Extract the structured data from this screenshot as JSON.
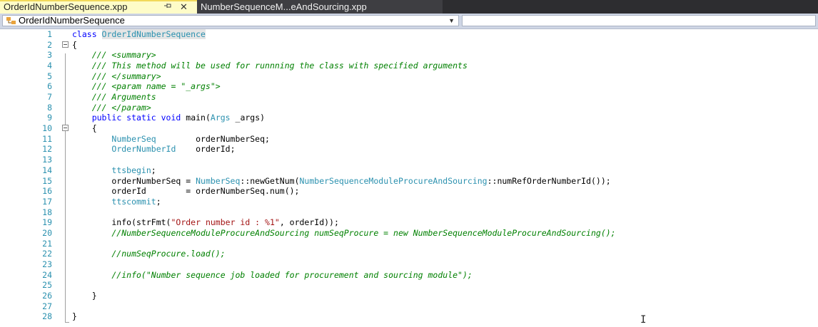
{
  "tabs": [
    {
      "label": "OrderIdNumberSequence.xpp",
      "pin_icon": "pin-icon",
      "close_glyph": "✕"
    },
    {
      "label": "NumberSequenceM...eAndSourcing.xpp"
    }
  ],
  "navbar": {
    "type_selector": "OrderIdNumberSequence",
    "member_selector": ""
  },
  "colors": {
    "keyword": "#0000ff",
    "type": "#2b91af",
    "comment": "#008000",
    "string": "#a31515",
    "line_number": "#2b91af"
  },
  "code": {
    "lines": [
      {
        "num": "1",
        "tokens": [
          {
            "c": "kw",
            "t": "class "
          },
          {
            "c": "ty hl",
            "t": "OrderIdNumberSequence"
          }
        ]
      },
      {
        "num": "2",
        "fold": true,
        "tokens": [
          {
            "c": "",
            "t": "{"
          }
        ]
      },
      {
        "num": "3",
        "tokens": [
          {
            "c": "cm",
            "t": "    /// <summary>"
          }
        ]
      },
      {
        "num": "4",
        "tokens": [
          {
            "c": "cm",
            "t": "    /// This method will be used for runnning the class with specified arguments"
          }
        ]
      },
      {
        "num": "5",
        "tokens": [
          {
            "c": "cm",
            "t": "    /// </summary>"
          }
        ]
      },
      {
        "num": "6",
        "tokens": [
          {
            "c": "cm",
            "t": "    /// <param name = \"_args\">"
          }
        ]
      },
      {
        "num": "7",
        "tokens": [
          {
            "c": "cm",
            "t": "    /// Arguments"
          }
        ]
      },
      {
        "num": "8",
        "tokens": [
          {
            "c": "cm",
            "t": "    /// </param>"
          }
        ]
      },
      {
        "num": "9",
        "tokens": [
          {
            "c": "",
            "t": "    "
          },
          {
            "c": "kw",
            "t": "public static void "
          },
          {
            "c": "",
            "t": "main("
          },
          {
            "c": "ty",
            "t": "Args"
          },
          {
            "c": "",
            "t": " _args)"
          }
        ]
      },
      {
        "num": "10",
        "fold": true,
        "tokens": [
          {
            "c": "",
            "t": "    {"
          }
        ]
      },
      {
        "num": "11",
        "tokens": [
          {
            "c": "",
            "t": "        "
          },
          {
            "c": "ty",
            "t": "NumberSeq"
          },
          {
            "c": "",
            "t": "        orderNumberSeq;"
          }
        ]
      },
      {
        "num": "12",
        "tokens": [
          {
            "c": "",
            "t": "        "
          },
          {
            "c": "ty",
            "t": "OrderNumberId"
          },
          {
            "c": "",
            "t": "    orderId;"
          }
        ]
      },
      {
        "num": "13",
        "tokens": []
      },
      {
        "num": "14",
        "tokens": [
          {
            "c": "",
            "t": "        "
          },
          {
            "c": "ty",
            "t": "ttsbegin"
          },
          {
            "c": "",
            "t": ";"
          }
        ]
      },
      {
        "num": "15",
        "tokens": [
          {
            "c": "",
            "t": "        orderNumberSeq = "
          },
          {
            "c": "ty",
            "t": "NumberSeq"
          },
          {
            "c": "",
            "t": "::newGetNum("
          },
          {
            "c": "ty",
            "t": "NumberSequenceModuleProcureAndSourcing"
          },
          {
            "c": "",
            "t": "::numRefOrderNumberId());"
          }
        ]
      },
      {
        "num": "16",
        "tokens": [
          {
            "c": "",
            "t": "        orderId        = orderNumberSeq.num();"
          }
        ]
      },
      {
        "num": "17",
        "tokens": [
          {
            "c": "",
            "t": "        "
          },
          {
            "c": "ty",
            "t": "ttscommit"
          },
          {
            "c": "",
            "t": ";"
          }
        ]
      },
      {
        "num": "18",
        "tokens": []
      },
      {
        "num": "19",
        "tokens": [
          {
            "c": "",
            "t": "        info(strFmt("
          },
          {
            "c": "st",
            "t": "\"Order number id : %1\""
          },
          {
            "c": "",
            "t": ", orderId));"
          }
        ]
      },
      {
        "num": "20",
        "tokens": [
          {
            "c": "cm",
            "t": "        //NumberSequenceModuleProcureAndSourcing numSeqProcure = new NumberSequenceModuleProcureAndSourcing();"
          }
        ]
      },
      {
        "num": "21",
        "tokens": []
      },
      {
        "num": "22",
        "tokens": [
          {
            "c": "cm",
            "t": "        //numSeqProcure.load();"
          }
        ]
      },
      {
        "num": "23",
        "tokens": []
      },
      {
        "num": "24",
        "tokens": [
          {
            "c": "cm",
            "t": "        //info(\"Number sequence job loaded for procurement and sourcing module\");"
          }
        ]
      },
      {
        "num": "25",
        "tokens": []
      },
      {
        "num": "26",
        "tokens": [
          {
            "c": "",
            "t": "    }"
          }
        ]
      },
      {
        "num": "27",
        "tokens": []
      },
      {
        "num": "28",
        "tokens": [
          {
            "c": "",
            "t": "}"
          }
        ]
      }
    ]
  },
  "cursor_glyph": "I"
}
